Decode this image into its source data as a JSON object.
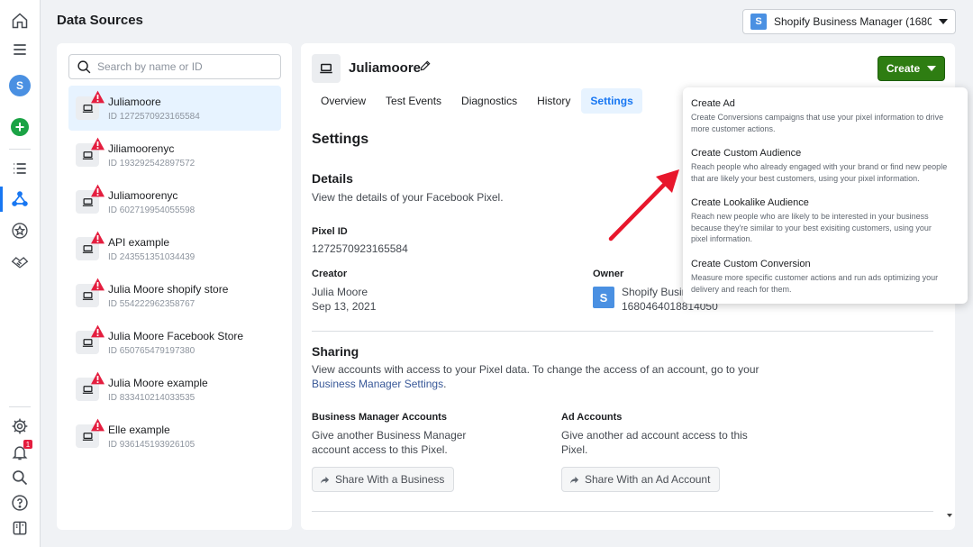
{
  "header": {
    "title": "Data Sources",
    "business_selector": {
      "initial": "S",
      "label": "Shopify Business Manager (1680..."
    }
  },
  "rail": {
    "icons": [
      "home-icon",
      "menu-icon",
      "account-avatar",
      "create-plus-icon",
      "list-icon",
      "events-manager-icon",
      "star-icon",
      "handshake-icon",
      "settings-icon",
      "notifications-icon",
      "search-icon",
      "help-icon",
      "panel-icon"
    ],
    "avatar_initial": "S",
    "notification_count": "1"
  },
  "search": {
    "placeholder": "Search by name or ID"
  },
  "sources": [
    {
      "name": "Juliamoore",
      "id": "ID 1272570923165584",
      "selected": true
    },
    {
      "name": "Jiliamoorenyc",
      "id": "ID 193292542897572"
    },
    {
      "name": "Juliamoorenyc",
      "id": "ID 602719954055598"
    },
    {
      "name": "API example",
      "id": "ID 243551351034439"
    },
    {
      "name": "Julia Moore shopify store",
      "id": "ID 554222962358767"
    },
    {
      "name": "Julia Moore Facebook Store",
      "id": "ID 650765479197380"
    },
    {
      "name": "Julia Moore example",
      "id": "ID 833410214033535"
    },
    {
      "name": "Elle example",
      "id": "ID 936145193926105"
    }
  ],
  "pixel": {
    "name": "Juliamoore",
    "create_label": "Create",
    "tabs": [
      "Overview",
      "Test Events",
      "Diagnostics",
      "History",
      "Settings"
    ],
    "active_tab": "Settings"
  },
  "settings": {
    "heading": "Settings",
    "details_heading": "Details",
    "details_desc": "View the details of your Facebook Pixel.",
    "pixel_id_label": "Pixel ID",
    "pixel_id_value": "1272570923165584",
    "creator_label": "Creator",
    "creator_name": "Julia Moore",
    "creator_date": "Sep 13, 2021",
    "owner_label": "Owner",
    "owner_initial": "S",
    "owner_name": "Shopify Busin",
    "owner_id": "1680464018814050",
    "sharing_heading": "Sharing",
    "sharing_desc": "View accounts with access to your Pixel data. To change the access of an account, go to your",
    "sharing_link": "Business Manager Settings",
    "sharing_link_suffix": ".",
    "bm_accounts_label": "Business Manager Accounts",
    "bm_accounts_desc_1": "Give another Business Manager",
    "bm_accounts_desc_2": "account access to this Pixel.",
    "bm_share_button": "Share With a Business",
    "ad_accounts_label": "Ad Accounts",
    "ad_accounts_desc_1": "Give another ad account access to this",
    "ad_accounts_desc_2": "Pixel.",
    "ad_share_button": "Share With an Ad Account"
  },
  "create_menu": [
    {
      "title": "Create Ad",
      "desc_1": "Create Conversions campaigns that use your pixel information to drive",
      "desc_2": "more customer actions."
    },
    {
      "title": "Create Custom Audience",
      "desc_1": "Reach people who already engaged with your brand or find new people",
      "desc_2": "that are likely your best customers, using your pixel information."
    },
    {
      "title": "Create Lookalike Audience",
      "desc_1": "Reach new people who are likely to be interested in your business",
      "desc_2": "because they're similar to your best exisiting customers, using your",
      "desc_3": "pixel information."
    },
    {
      "title": "Create Custom Conversion",
      "desc_1": "Measure more specific customer actions and run ads optimizing your",
      "desc_2": "delivery and reach for them."
    }
  ],
  "colors": {
    "accent": "#1877f2",
    "create_button": "#2e7d12",
    "warning": "#e41e3f",
    "arrow": "#e8172c"
  }
}
